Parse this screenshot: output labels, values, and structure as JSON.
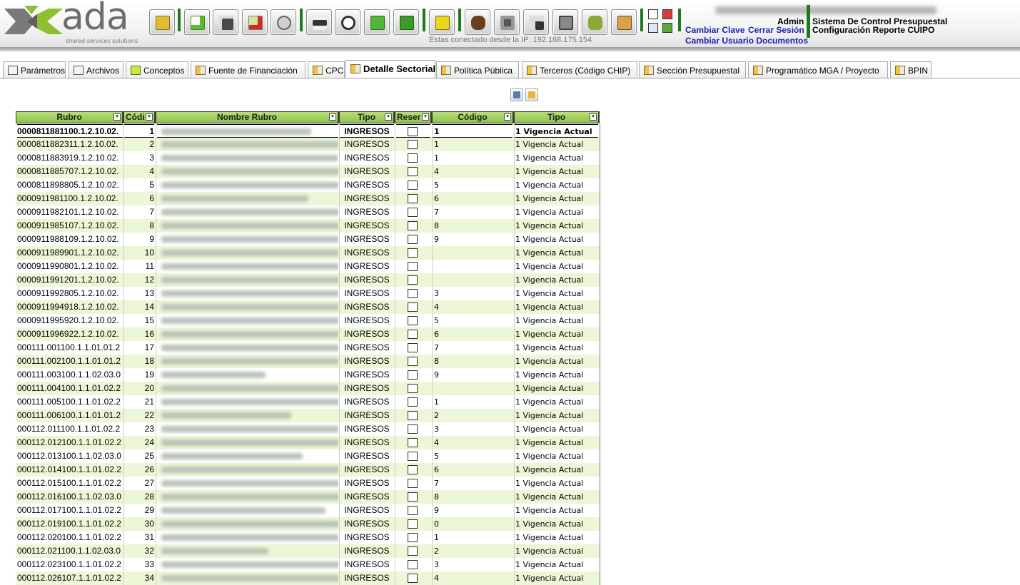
{
  "header": {
    "logo_text": "ada",
    "logo_tagline": "shared services solutions",
    "toolbar_icons": [
      "open-folder-icon",
      "new-document-icon",
      "save-icon",
      "delete-icon",
      "undo-icon",
      "print-icon",
      "search-icon",
      "export-image-icon",
      "folder-export-icon",
      "lock-icon",
      "money-icon",
      "camera-icon",
      "grid-icon",
      "cart-icon",
      "hand-icon",
      "users-icon"
    ],
    "ip_text": "Estas conectado desde la IP: 192.168.175.154",
    "user_name": "Admin",
    "links": {
      "change_key": "Cambiar Clave",
      "logout": "Cerrar Sesión",
      "change_user_docs": "Cambiar Usuario Documentos"
    },
    "system_title": "Sistema De Control Presupuestal",
    "system_subtitle": "Configuración Reporte CUIPO",
    "accent_color": "#1e7a1e",
    "link_color": "#1a23b4"
  },
  "tabs": [
    {
      "label": "Parámetros",
      "icon": "list-icon"
    },
    {
      "label": "Archivos",
      "icon": "file-icon"
    },
    {
      "label": "Conceptos",
      "icon": "concept-icon"
    },
    {
      "label": "Fuente de Financiación",
      "icon": "arrow-icon"
    },
    {
      "label": "CPC",
      "icon": "arrow-icon"
    },
    {
      "label": "Detalle Sectorial",
      "icon": "arrow-icon",
      "active": true
    },
    {
      "label": "Política Pública",
      "icon": "arrow-icon"
    },
    {
      "label": "Terceros (Código CHIP)",
      "icon": "arrow-icon"
    },
    {
      "label": "Sección Presupuestal",
      "icon": "arrow-icon"
    },
    {
      "label": "Programático MGA / Proyecto",
      "icon": "arrow-icon"
    },
    {
      "label": "BPIN",
      "icon": "arrow-icon"
    }
  ],
  "grid_toolbar": [
    "save-grid-icon",
    "open-grid-icon"
  ],
  "grid": {
    "header_color": "#9fce5a",
    "alt_row_color": "#ebf7d6",
    "columns": [
      "Rubro",
      "Códi",
      "Nombre Rubro",
      "Tipo",
      "Reser",
      "Código",
      "Tipo"
    ],
    "rows": [
      {
        "rubro": "0000811881100.1.2.10.02.",
        "cod": "1",
        "tipo": "INGRESOS",
        "codigo": "1",
        "vig": "1 Vigencia Actual"
      },
      {
        "rubro": "0000811882311.1.2.10.02.",
        "cod": "2",
        "tipo": "INGRESOS",
        "codigo": "1",
        "vig": "1 Vigencia Actual"
      },
      {
        "rubro": "0000811883919.1.2.10.02.",
        "cod": "3",
        "tipo": "INGRESOS",
        "codigo": "1",
        "vig": "1 Vigencia Actual"
      },
      {
        "rubro": "0000811885707.1.2.10.02.",
        "cod": "4",
        "tipo": "INGRESOS",
        "codigo": "4",
        "vig": "1 Vigencia Actual"
      },
      {
        "rubro": "0000811898805.1.2.10.02.",
        "cod": "5",
        "tipo": "INGRESOS",
        "codigo": "5",
        "vig": "1 Vigencia Actual"
      },
      {
        "rubro": "0000911981100.1.2.10.02.",
        "cod": "6",
        "tipo": "INGRESOS",
        "codigo": "6",
        "vig": "1 Vigencia Actual"
      },
      {
        "rubro": "0000911982101.1.2.10.02.",
        "cod": "7",
        "tipo": "INGRESOS",
        "codigo": "7",
        "vig": "1 Vigencia Actual"
      },
      {
        "rubro": "0000911985107.1.2.10.02.",
        "cod": "8",
        "tipo": "INGRESOS",
        "codigo": "8",
        "vig": "1 Vigencia Actual"
      },
      {
        "rubro": "0000911988109.1.2.10.02.",
        "cod": "9",
        "tipo": "INGRESOS",
        "codigo": "9",
        "vig": "1 Vigencia Actual"
      },
      {
        "rubro": "0000911989901.1.2.10.02.",
        "cod": "10",
        "tipo": "INGRESOS",
        "codigo": "",
        "vig": "1 Vigencia Actual"
      },
      {
        "rubro": "0000911990801.1.2.10.02.",
        "cod": "11",
        "tipo": "INGRESOS",
        "codigo": "",
        "vig": "1 Vigencia Actual"
      },
      {
        "rubro": "0000911991201.1.2.10.02.",
        "cod": "12",
        "tipo": "INGRESOS",
        "codigo": "",
        "vig": "1 Vigencia Actual"
      },
      {
        "rubro": "0000911992805.1.2.10.02.",
        "cod": "13",
        "tipo": "INGRESOS",
        "codigo": "3",
        "vig": "1 Vigencia Actual"
      },
      {
        "rubro": "0000911994918.1.2.10.02.",
        "cod": "14",
        "tipo": "INGRESOS",
        "codigo": "4",
        "vig": "1 Vigencia Actual"
      },
      {
        "rubro": "0000911995920.1.2.10.02.",
        "cod": "15",
        "tipo": "INGRESOS",
        "codigo": "5",
        "vig": "1 Vigencia Actual"
      },
      {
        "rubro": "0000911996922.1.2.10.02.",
        "cod": "16",
        "tipo": "INGRESOS",
        "codigo": "6",
        "vig": "1 Vigencia Actual"
      },
      {
        "rubro": "000111.001100.1.1.01.01.2",
        "cod": "17",
        "tipo": "INGRESOS",
        "codigo": "7",
        "vig": "1 Vigencia Actual"
      },
      {
        "rubro": "000111.002100.1.1.01.01.2",
        "cod": "18",
        "tipo": "INGRESOS",
        "codigo": "8",
        "vig": "1 Vigencia Actual"
      },
      {
        "rubro": "000111.003100.1.1.02.03.0",
        "cod": "19",
        "tipo": "INGRESOS",
        "codigo": "9",
        "vig": "1 Vigencia Actual"
      },
      {
        "rubro": "000111.004100.1.1.01.02.2",
        "cod": "20",
        "tipo": "INGRESOS",
        "codigo": "",
        "vig": "1 Vigencia Actual"
      },
      {
        "rubro": "000111.005100.1.1.01.02.2",
        "cod": "21",
        "tipo": "INGRESOS",
        "codigo": "1",
        "vig": "1 Vigencia Actual"
      },
      {
        "rubro": "000111.006100.1.1.01.01.2",
        "cod": "22",
        "tipo": "INGRESOS",
        "codigo": "2",
        "vig": "1 Vigencia Actual"
      },
      {
        "rubro": "000112.011100.1.1.01.02.2",
        "cod": "23",
        "tipo": "INGRESOS",
        "codigo": "3",
        "vig": "1 Vigencia Actual"
      },
      {
        "rubro": "000112.012100.1.1.01.02.2",
        "cod": "24",
        "tipo": "INGRESOS",
        "codigo": "4",
        "vig": "1 Vigencia Actual"
      },
      {
        "rubro": "000112.013100.1.1.02.03.0",
        "cod": "25",
        "tipo": "INGRESOS",
        "codigo": "5",
        "vig": "1 Vigencia Actual"
      },
      {
        "rubro": "000112.014100.1.1.01.02.2",
        "cod": "26",
        "tipo": "INGRESOS",
        "codigo": "6",
        "vig": "1 Vigencia Actual"
      },
      {
        "rubro": "000112.015100.1.1.01.02.2",
        "cod": "27",
        "tipo": "INGRESOS",
        "codigo": "7",
        "vig": "1 Vigencia Actual"
      },
      {
        "rubro": "000112.016100.1.1.02.03.0",
        "cod": "28",
        "tipo": "INGRESOS",
        "codigo": "8",
        "vig": "1 Vigencia Actual"
      },
      {
        "rubro": "000112.017100.1.1.01.02.2",
        "cod": "29",
        "tipo": "INGRESOS",
        "codigo": "9",
        "vig": "1 Vigencia Actual"
      },
      {
        "rubro": "000112.019100.1.1.01.02.2",
        "cod": "30",
        "tipo": "INGRESOS",
        "codigo": "0",
        "vig": "1 Vigencia Actual"
      },
      {
        "rubro": "000112.020100.1.1.01.02.2",
        "cod": "31",
        "tipo": "INGRESOS",
        "codigo": "1",
        "vig": "1 Vigencia Actual"
      },
      {
        "rubro": "000112.021100.1.1.02.03.0",
        "cod": "32",
        "tipo": "INGRESOS",
        "codigo": "2",
        "vig": "1 Vigencia Actual"
      },
      {
        "rubro": "000112.023100.1.1.01.02.2",
        "cod": "33",
        "tipo": "INGRESOS",
        "codigo": "3",
        "vig": "1 Vigencia Actual"
      },
      {
        "rubro": "000112.026107.1.1.01.02.2",
        "cod": "34",
        "tipo": "INGRESOS",
        "codigo": "4",
        "vig": "1 Vigencia Actual"
      }
    ]
  }
}
